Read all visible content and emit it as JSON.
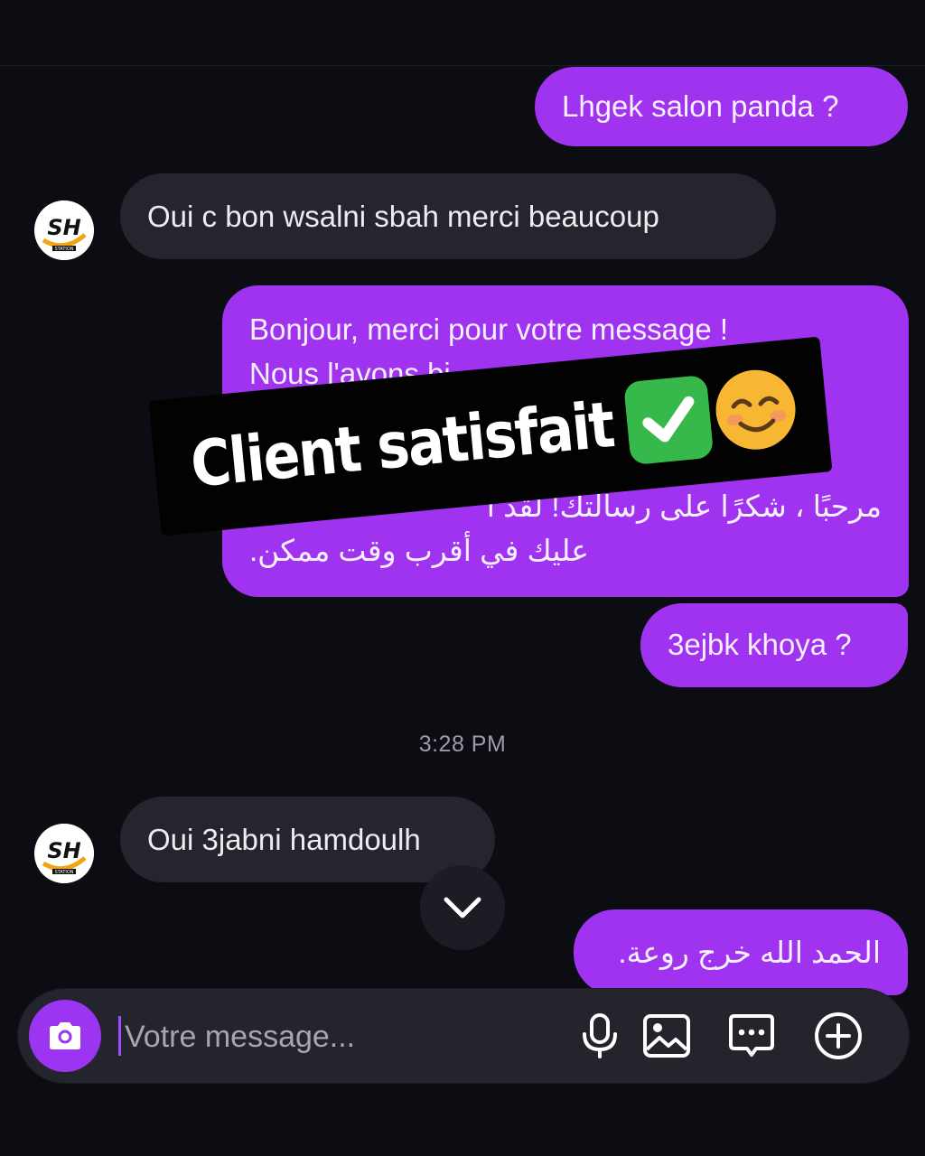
{
  "messages": [
    {
      "side": "out",
      "text": "Lhgek salon panda ?"
    },
    {
      "side": "in",
      "text": "Oui c bon wsalni sbah merci beaucoup"
    },
    {
      "side": "out",
      "lines": [
        "Bonjour, merci pour votre message !",
        "Nous l'avons bi",
        "",
        "",
        "مرحبًا ، شكرًا على رسالتك! لقد ا",
        "عليك في أقرب وقت ممكن."
      ]
    },
    {
      "side": "out",
      "text": "3ejbk khoya ?"
    },
    {
      "side": "in",
      "text": "Oui 3jabni hamdoulh"
    },
    {
      "side": "out",
      "text": "الحمد الله خرج روعة."
    }
  ],
  "timestamp": "3:28 PM",
  "sticker": {
    "text": "Client satisfait",
    "emoji": [
      "check-mark",
      "smiling-face"
    ]
  },
  "avatar": {
    "initials": "SH",
    "caption": "STATION",
    "icon": "station-logo"
  },
  "composer": {
    "placeholder": "Votre message...",
    "value": "",
    "icons": [
      "camera-icon",
      "microphone-icon",
      "gallery-icon",
      "sticker-chat-icon",
      "plus-circle-icon"
    ]
  },
  "colors": {
    "outgoing": "#a033f0",
    "incoming": "#25252e",
    "background": "#0c0c13",
    "accent": "#9b35f2"
  }
}
